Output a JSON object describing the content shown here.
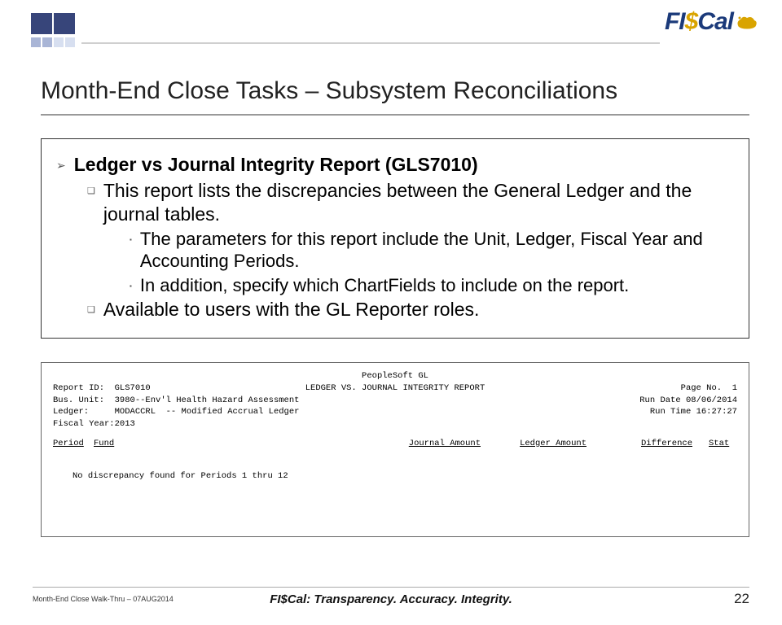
{
  "logo": {
    "text_pre": "FI",
    "text_dollar": "$",
    "text_post": "Cal"
  },
  "title": "Month-End Close Tasks – Subsystem Reconciliations",
  "bullets": {
    "l1": "Ledger vs Journal Integrity Report  (GLS7010)",
    "l2a": "This report lists the discrepancies between the General Ledger and the journal tables.",
    "l3a": "The parameters for this report include the Unit, Ledger, Fiscal Year and Accounting Periods.",
    "l3b": "In addition, specify which ChartFields to include on the report.",
    "l2b": "Available to users with the GL Reporter roles."
  },
  "report": {
    "system": "PeopleSoft GL",
    "title": "LEDGER VS. JOURNAL INTEGRITY REPORT",
    "id_label": "Report ID:",
    "id_val": "GLS7010",
    "unit_label": "Bus. Unit:",
    "unit_val": "3980--Env'l Health Hazard Assessment",
    "ledger_label": "Ledger:",
    "ledger_val": "MODACCRL  -- Modified Accrual Ledger",
    "fy_label": "Fiscal Year:",
    "fy_val": "2013",
    "page_label": "Page No.",
    "page_val": "1",
    "date_label": "Run Date",
    "date_val": "08/06/2014",
    "time_label": "Run Time",
    "time_val": "16:27:27",
    "cols": {
      "period": "Period",
      "fund": "Fund",
      "journal": "Journal Amount",
      "ledger": "Ledger Amount",
      "diff": "Difference",
      "stat": "Stat"
    },
    "body": "No discrepancy found for Periods   1 thru  12"
  },
  "footer": {
    "left": "Month-End Close Walk-Thru – 07AUG2014",
    "center": "FI$Cal: Transparency. Accuracy. Integrity.",
    "page": "22"
  }
}
